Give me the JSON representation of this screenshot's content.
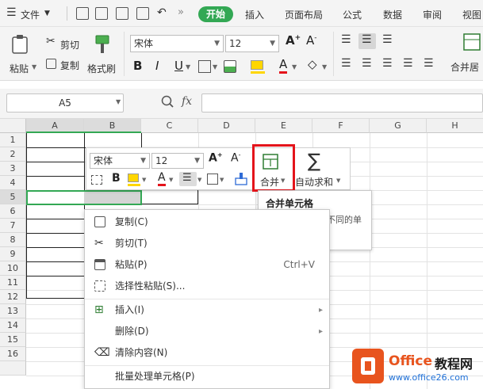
{
  "menubar": {
    "file_menu": "文件",
    "tabs": [
      "开始",
      "插入",
      "页面布局",
      "公式",
      "数据",
      "审阅",
      "视图"
    ],
    "active_tab": "开始"
  },
  "ribbon": {
    "paste": "粘贴",
    "cut": "剪切",
    "copy": "复制",
    "format_painter": "格式刷",
    "font_name": "宋体",
    "font_size": "12",
    "bold": "B",
    "italic": "I",
    "underline": "U",
    "font_color_letter": "A",
    "merge_center": "合并居"
  },
  "formulabar": {
    "name_box": "A5",
    "fx": "fx"
  },
  "grid": {
    "columns": [
      "A",
      "B",
      "C",
      "D",
      "E",
      "F",
      "G",
      "H"
    ],
    "rows": [
      "1",
      "2",
      "3",
      "4",
      "5",
      "6",
      "7",
      "8",
      "9",
      "10",
      "11",
      "12",
      "13",
      "14",
      "15",
      "16"
    ]
  },
  "mini_toolbar": {
    "font_name": "宋体",
    "font_size": "12",
    "bold": "B",
    "font_color_letter": "A",
    "merge_label": "合并",
    "autosum_label": "自动求和"
  },
  "tooltip": {
    "title": "合并单元格",
    "body": "单击此处可选择不同的单元格合并方式。"
  },
  "context_menu": {
    "items": [
      {
        "label": "复制(C)",
        "shortcut": ""
      },
      {
        "label": "剪切(T)",
        "shortcut": ""
      },
      {
        "label": "粘贴(P)",
        "shortcut": "Ctrl+V"
      },
      {
        "label": "选择性粘贴(S)...",
        "shortcut": ""
      },
      {
        "label": "插入(I)",
        "shortcut": ""
      },
      {
        "label": "删除(D)",
        "shortcut": ""
      },
      {
        "label": "清除内容(N)",
        "shortcut": ""
      },
      {
        "label": "批量处理单元格(P)",
        "shortcut": ""
      }
    ]
  },
  "watermark": {
    "brand_a": "Office",
    "brand_b": "教程网",
    "url": "www.office26.com"
  },
  "colors": {
    "accent_green": "#33a854",
    "highlight_red": "#e4141b",
    "logo_orange": "#e8541e"
  }
}
